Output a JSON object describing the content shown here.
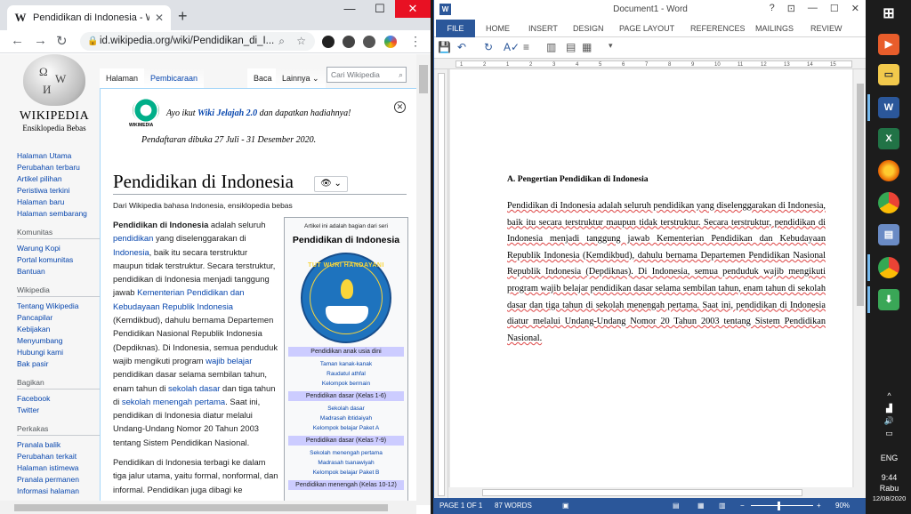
{
  "chrome": {
    "tab_title": "Pendidikan di Indonesia - Wikipe",
    "tab_close": "✕",
    "new_tab": "+",
    "minimize": "—",
    "maximize": "☐",
    "close": "✕",
    "url": "id.wikipedia.org/wiki/Pendidikan_di_I...",
    "menu": "⋮"
  },
  "wikipedia": {
    "logo_name": "WIKIPEDIA",
    "logo_sub": "Ensiklopedia Bebas",
    "tabs": {
      "halaman": "Halaman",
      "pembicaraan": "Pembicaraan",
      "baca": "Baca",
      "lainnya": "Lainnya ⌄"
    },
    "search_placeholder": "Cari Wikipedia",
    "sidebar": {
      "main_links": [
        "Halaman Utama",
        "Perubahan terbaru",
        "Artikel pilihan",
        "Peristiwa terkini",
        "Halaman baru",
        "Halaman sembarang"
      ],
      "komunitas_title": "Komunitas",
      "komunitas_links": [
        "Warung Kopi",
        "Portal komunitas",
        "Bantuan"
      ],
      "wikipedia_title": "Wikipedia",
      "wikipedia_links": [
        "Tentang Wikipedia",
        "Pancapilar",
        "Kebijakan",
        "Menyumbang",
        "Hubungi kami",
        "Bak pasir"
      ],
      "bagikan_title": "Bagikan",
      "bagikan_links": [
        "Facebook",
        "Twitter"
      ],
      "perkakas_title": "Perkakas",
      "perkakas_links": [
        "Pranala balik",
        "Perubahan terkait",
        "Halaman istimewa",
        "Pranala permanen",
        "Informasi halaman"
      ]
    },
    "banner": {
      "pre": "Ayo ikut ",
      "link": "Wiki Jelajah 2.0",
      "post": " dan dapatkan hadiahnya!",
      "dates": "Pendaftaran dibuka 27 Juli - 31 Desember 2020.",
      "logo_label": "WIKIMEDIA"
    },
    "title": "Pendidikan di Indonesia",
    "from": "Dari Wikipedia bahasa Indonesia, ensiklopedia bebas",
    "body": {
      "p1_bold": "Pendidikan di Indonesia",
      "p1_a": " adalah seluruh ",
      "p1_link1": "pendidikan",
      "p1_b": " yang diselenggarakan di ",
      "p1_link2": "Indonesia",
      "p1_c": ", baik itu secara terstruktur maupun tidak terstruktur. Secara terstruktur, pendidikan di Indonesia menjadi tanggung jawab ",
      "p1_link3": "Kementerian Pendidikan dan Kebudayaan Republik Indonesia",
      "p1_d": " (Kemdikbud), dahulu bernama Departemen Pendidikan Nasional Republik Indonesia (Depdiknas). Di Indonesia, semua penduduk wajib mengikuti program ",
      "p1_link4": "wajib belajar",
      "p1_e": " pendidikan dasar selama sembilan tahun, enam tahun di ",
      "p1_link5": "sekolah dasar",
      "p1_f": " dan tiga tahun di ",
      "p1_link6": "sekolah menengah pertama",
      "p1_g": ". Saat ini, pendidikan di Indonesia diatur melalui Undang-Undang Nomor 20 Tahun 2003 tentang Sistem Pendidikan Nasional.",
      "p2": "Pendidikan di Indonesia terbagi ke dalam tiga jalur utama, yaitu formal, nonformal, dan informal. Pendidikan juga dibagi ke"
    },
    "infobox": {
      "top": "Artikel ini adalah bagian dari seri",
      "title": "Pendidikan di Indonesia",
      "emblem_text": "TUT WURI HANDAYANI",
      "sec1": "Pendidikan anak usia dini",
      "sec1_items": [
        "Taman kanak-kanak",
        "Raudatul athfal",
        "Kelompok bermain"
      ],
      "sec2": "Pendidikan dasar (Kelas 1-6)",
      "sec2_items": [
        "Sekolah dasar",
        "Madrasah ibtidaiyah",
        "Kelompok belajar Paket A"
      ],
      "sec3": "Pendidikan dasar (Kelas 7-9)",
      "sec3_items": [
        "Sekolah menengah pertama",
        "Madrasah tsanawiyah",
        "Kelompok belajar Paket B"
      ],
      "sec4": "Pendidikan menengah (Kelas 10-12)"
    }
  },
  "word": {
    "title": "Document1 - Word",
    "help": "?",
    "ribbon_tabs": [
      "FILE",
      "HOME",
      "INSERT",
      "DESIGN",
      "PAGE LAYOUT",
      "REFERENCES",
      "MAILINGS",
      "REVIEW"
    ],
    "ruler_numbers": [
      "1",
      "2",
      "1",
      "2",
      "3",
      "4",
      "5",
      "6",
      "7",
      "8",
      "9",
      "10",
      "11",
      "12",
      "13",
      "14",
      "15"
    ],
    "heading": "A. Pengertian Pendidikan di Indonesia",
    "paragraph": "Pendidikan di Indonesia adalah seluruh pendidikan yang diselenggarakan di Indonesia, baik itu secara terstruktur maupun tidak terstruktur. Secara terstruktur, pendidikan di Indonesia menjadi tanggung jawab Kementerian Pendidikan dan Kebudayaan Republik Indonesia (Kemdikbud), dahulu bernama Departemen Pendidikan Nasional Republik Indonesia (Depdiknas). Di Indonesia, semua penduduk wajib mengikuti program wajib belajar pendidikan dasar selama sembilan tahun, enam tahun di sekolah dasar dan tiga tahun di sekolah menengah pertama. Saat ini, pendidikan di Indonesia diatur melalui Undang-Undang Nomor 20 Tahun 2003 tentang Sistem Pendidikan Nasional.",
    "status": {
      "page": "PAGE 1 OF 1",
      "words": "87 WORDS",
      "zoom": "90%"
    }
  },
  "taskbar": {
    "lang": "ENG",
    "time": "9:44",
    "day": "Rabu",
    "date": "12/08/2020"
  }
}
